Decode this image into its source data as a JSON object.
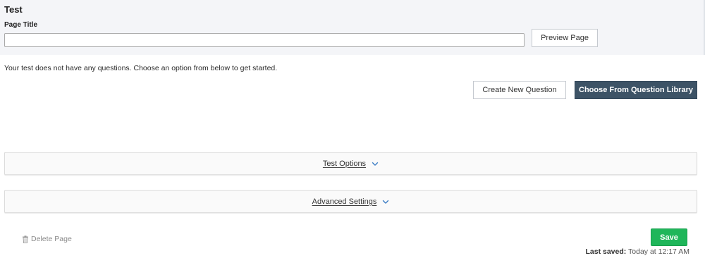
{
  "header": {
    "page_heading": "Test",
    "title_label": "Page Title",
    "title_value": "",
    "preview_label": "Preview Page"
  },
  "questions": {
    "empty_message": "Your test does not have any questions. Choose an option from below to get started.",
    "create_label": "Create New Question",
    "library_label": "Choose From Question Library"
  },
  "sections": {
    "test_options_label": "Test Options",
    "advanced_settings_label": "Advanced Settings"
  },
  "footer": {
    "delete_label": "Delete Page",
    "save_label": "Save",
    "last_saved_label": "Last saved:",
    "last_saved_value": "Today at 12:17 AM"
  },
  "icons": {
    "chevron": "chevron-down-icon",
    "trash": "trash-icon"
  },
  "colors": {
    "primary_dark": "#3d5366",
    "save_green": "#1fb65a",
    "chevron_blue": "#3a7cc4",
    "top_panel_bg": "#f4f5f8"
  }
}
